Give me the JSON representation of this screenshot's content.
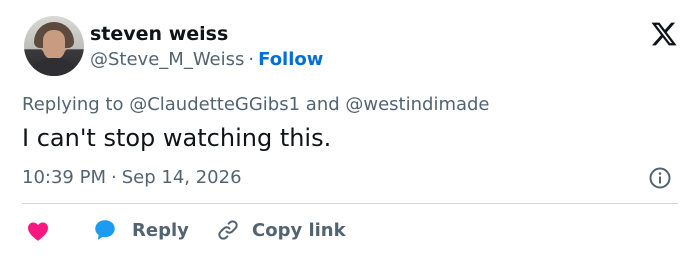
{
  "author": {
    "name": "steven weiss",
    "handle": "@Steve_M_Weiss",
    "separator": "·",
    "follow_label": "Follow"
  },
  "reply_context": {
    "prefix": "Replying to ",
    "mention_1": "@ClaudetteGGibs1",
    "conjunction": " and ",
    "mention_2": "@westindimade"
  },
  "tweet": {
    "text": "I can't stop watching this."
  },
  "meta": {
    "time": "10:39 PM",
    "separator": "·",
    "date": "Sep 14, 2026"
  },
  "actions": {
    "reply_label": "Reply",
    "copy_link_label": "Copy link"
  },
  "icons": {
    "logo": "x-logo-icon",
    "info": "info-icon",
    "like": "heart-icon",
    "reply": "speech-bubble-icon",
    "copy": "link-icon"
  },
  "colors": {
    "follow": "#006fd6",
    "heart": "#f91880",
    "reply_bubble": "#1d9bf0",
    "secondary_text": "#536471"
  }
}
